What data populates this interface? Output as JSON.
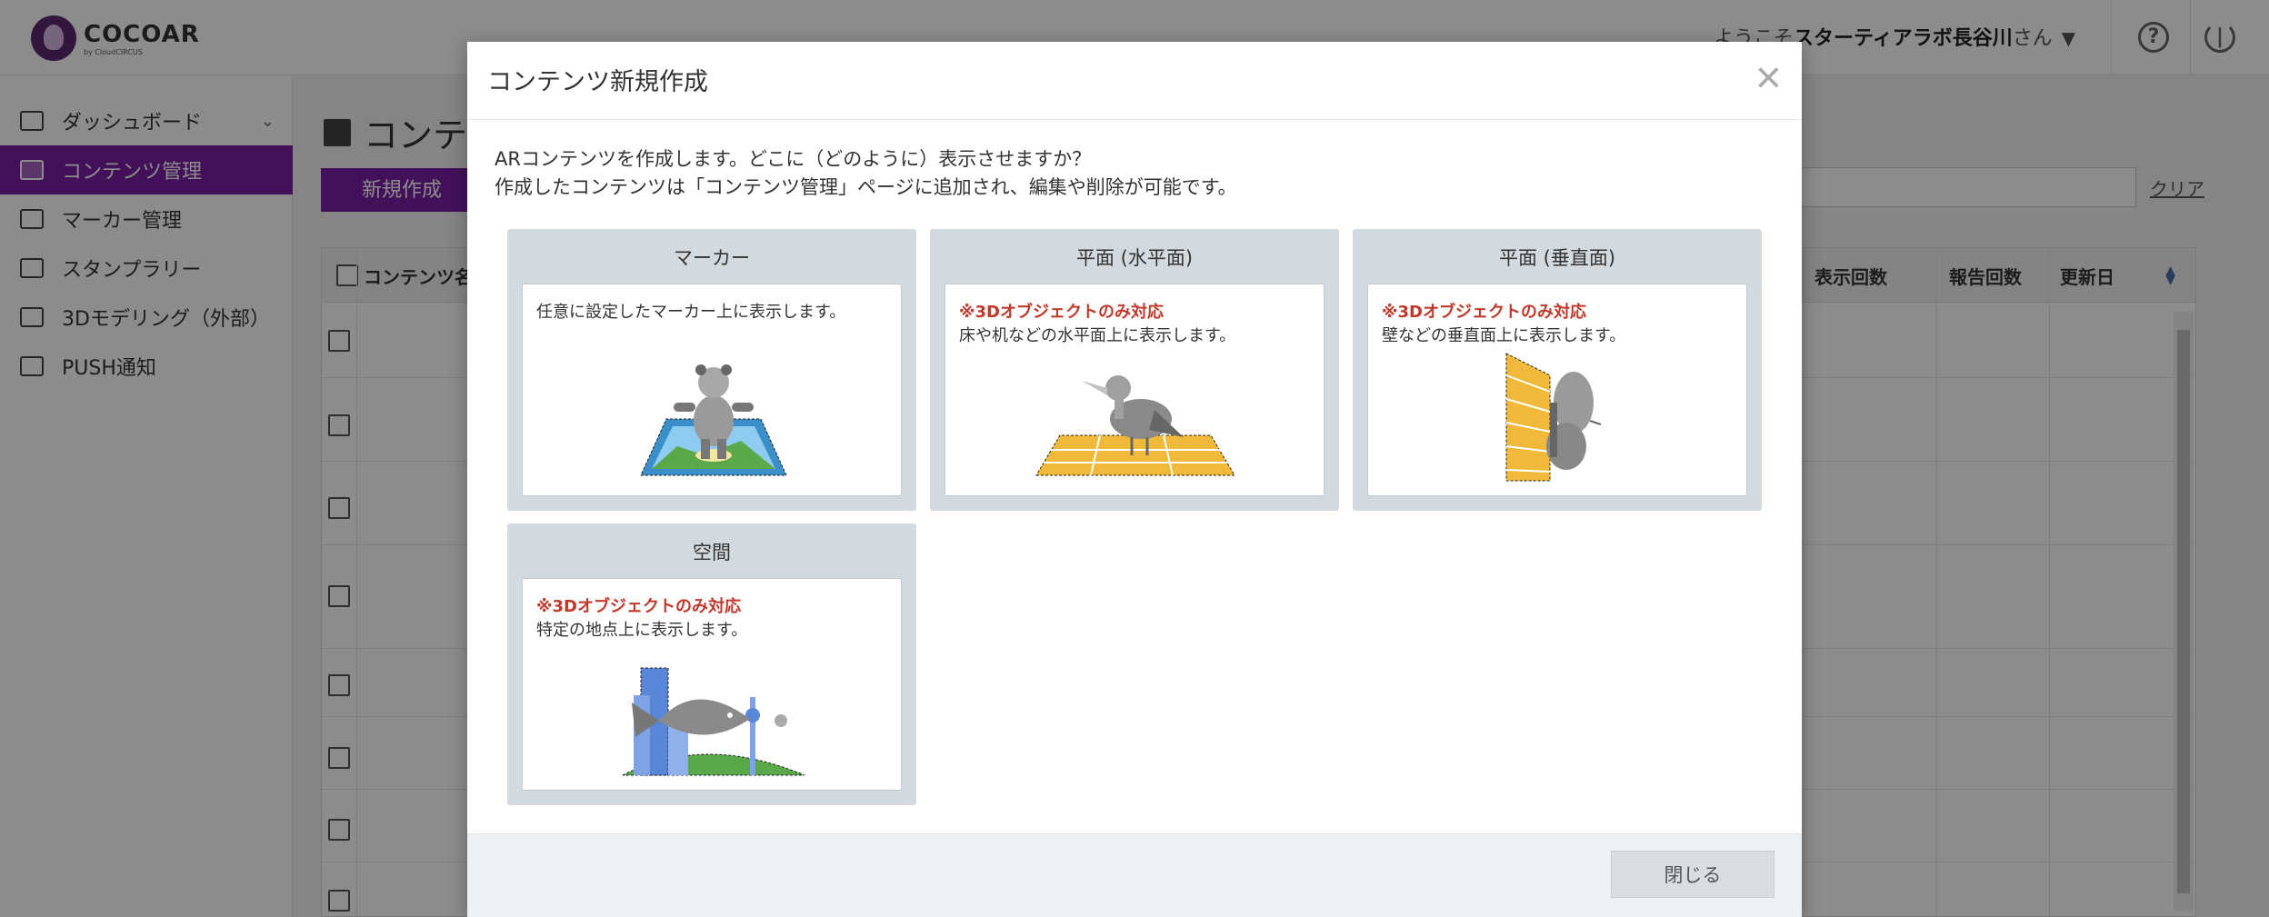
{
  "app": {
    "logo_name": "COCOAR",
    "logo_sub": "by CloudCIRCUS",
    "welcome_prefix": "ようこそ",
    "user_name": "スターティアラボ長谷川",
    "welcome_suffix": "さん",
    "help_icon": "question-circle-icon",
    "power_icon": "power-icon"
  },
  "sidebar": {
    "items": [
      {
        "label": "ダッシュボード",
        "icon": "chart-line-icon"
      },
      {
        "label": "コンテンツ管理",
        "icon": "archive-icon"
      },
      {
        "label": "マーカー管理",
        "icon": "image-icon"
      },
      {
        "label": "スタンプラリー",
        "icon": "map-icon"
      },
      {
        "label": "3Dモデリング（外部）",
        "icon": "cubes-icon"
      },
      {
        "label": "PUSH通知",
        "icon": "bell-icon"
      }
    ]
  },
  "main": {
    "title": "コンテ",
    "new_button": "新規作成",
    "clear_link": "クリア",
    "table_headers": {
      "name": "コンテンツ名",
      "views": "表示回数",
      "reports": "報告回数",
      "updated": "更新日"
    }
  },
  "modal": {
    "title": "コンテンツ新規作成",
    "intro_line1": "ARコンテンツを作成します。どこに（どのように）表示させますか？",
    "intro_line2": "作成したコンテンツは「コンテンツ管理」ページに追加され、編集や削除が可能です。",
    "options": [
      {
        "title": "マーカー",
        "warning": "",
        "desc": "任意に設定したマーカー上に表示します。"
      },
      {
        "title": "平面 (水平面)",
        "warning": "※3Dオブジェクトのみ対応",
        "desc": "床や机などの水平面上に表示します。"
      },
      {
        "title": "平面 (垂直面)",
        "warning": "※3Dオブジェクトのみ対応",
        "desc": "壁などの垂直面上に表示します。"
      },
      {
        "title": "空間",
        "warning": "※3Dオブジェクトのみ対応",
        "desc": "特定の地点上に表示します。"
      }
    ],
    "close_button": "閉じる"
  }
}
